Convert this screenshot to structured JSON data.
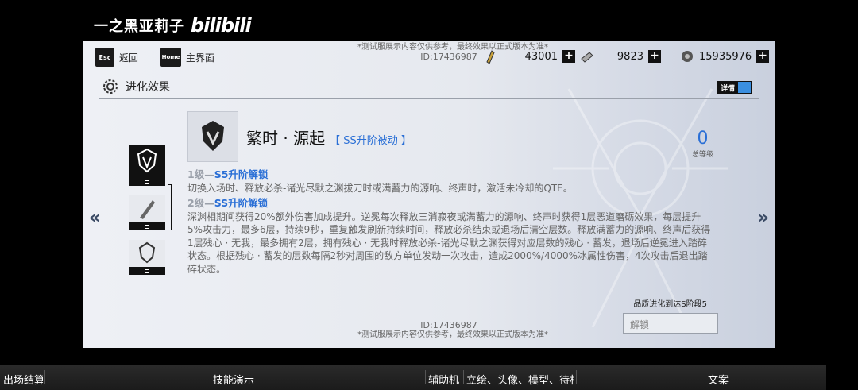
{
  "uploader": {
    "name": "一之黑亚莉子",
    "logo": "bilibili"
  },
  "topbar": {
    "esc_key": "Esc",
    "back_label": "返回",
    "home_key": "Home",
    "home_label": "主界面",
    "disclaimer": "*测试服展示内容仅供参考，最终效果以正式版本为准*",
    "id_text": "ID:17436987",
    "resources": [
      {
        "icon": "stamina-icon",
        "value": "43001"
      },
      {
        "icon": "card-icon",
        "value": "9823"
      },
      {
        "icon": "coin-icon",
        "value": "15935976"
      }
    ]
  },
  "section": {
    "title": "进化效果",
    "detail_label": "详情"
  },
  "skill": {
    "name": "繁时 · 源起",
    "tag": "【 SS升阶被动 】",
    "level_value": "0",
    "level_label": "总等级",
    "tiers": [
      {
        "prefix": "1级—",
        "title": "S5升阶解锁",
        "text": "切换入场时、释放必杀-诸光尽默之渊拔刀时或满蓄力的源响、终声时，激活未冷却的QTE。"
      },
      {
        "prefix": "2级—",
        "title": "SS升阶解锁",
        "text": "深渊相期间获得20%额外伤害加成提升。逆冕每次释放三消寂夜或满蓄力的源响、终声时获得1层恶道磨砺效果，每层提升5%攻击力，最多6层，持续9秒，重复触发刷新持续时间，释放必杀结束或退场后清空层数。释放满蓄力的源响、终声后获得1层残心 · 无我，最多拥有2层，拥有残心 · 无我时释放必杀-诸光尽默之渊获得对应层数的残心 · 蓄发，退场后逆冕进入踏碎状态。根据残心 · 蓄发的层数每隔2秒对周围的敌方单位发动一次攻击，造成2000%/4000%冰属性伤害，4次攻击后退出踏碎状态。"
      }
    ]
  },
  "unlock": {
    "requirement": "品质进化到达S阶段5",
    "button_label": "解锁"
  },
  "footer": {
    "id_text": "ID:17436987",
    "disclaimer": "*测试服展示内容仅供参考，最终效果以正式版本为准*"
  },
  "bottom_tabs": [
    {
      "label": "出场结算"
    },
    {
      "label": "技能演示"
    },
    {
      "label": "辅助机"
    },
    {
      "label": "立绘、头像、模型、待机"
    },
    {
      "label": "文案"
    }
  ],
  "colors": {
    "accent": "#2a6fd6",
    "panel": "#e8ebf0",
    "dark": "#111111"
  }
}
